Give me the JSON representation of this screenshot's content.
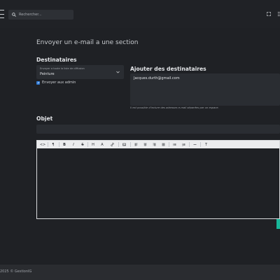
{
  "header": {
    "search_placeholder": "Rechercher..."
  },
  "page": {
    "title": "Envoyer un e-mail a une section"
  },
  "recipients": {
    "heading": "Destinataires",
    "list_label": "Envoyer a toute la liste de diffusion",
    "list_value": "Peinture",
    "admin_checkbox_label": "Envoyer aux admin",
    "admin_checked": true
  },
  "add_recipients": {
    "heading": "Ajouter des destinataires",
    "value": "Jacques.durth@gmail.com",
    "help": "Il est possible d'inclure des adresses e-mail séparées par un espace."
  },
  "subject": {
    "heading": "Objet",
    "value": ""
  },
  "editor": {
    "toolbar": {
      "code": "<>",
      "paragraph": "¶",
      "bold": "B",
      "italic": "I",
      "strike": "S",
      "heading": "H",
      "text_size": "A",
      "clear": "T"
    },
    "content": ""
  },
  "footer": {
    "copyright": "2025 © GestionIG"
  },
  "colors": {
    "background": "#1f2125",
    "accent": "#18b79a",
    "checkbox": "#2f7ad6"
  }
}
